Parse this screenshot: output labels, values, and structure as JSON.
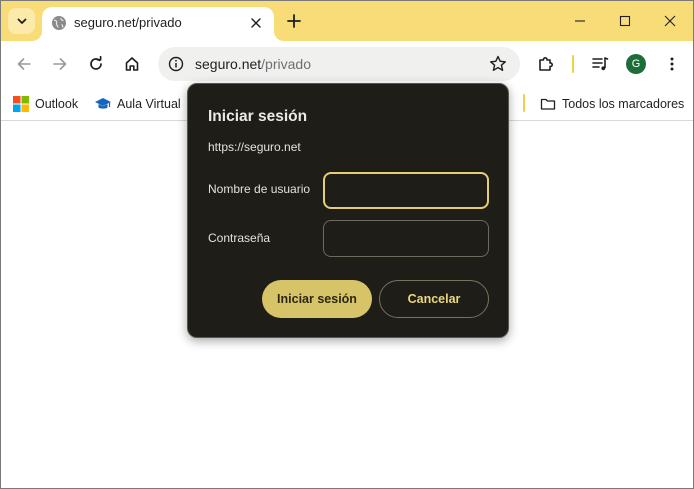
{
  "tab": {
    "title": "seguro.net/privado",
    "favicon": "globe-icon"
  },
  "window_controls": [
    "minimize-icon",
    "maximize-icon",
    "close-icon"
  ],
  "toolbar": {
    "url_host": "seguro.net",
    "url_path": "/privado",
    "profile_initial": "G"
  },
  "bookmarks": [
    {
      "label": "Outlook",
      "icon": "microsoft-logo-icon"
    },
    {
      "label": "Aula Virtual",
      "icon": "graduation-cap-icon"
    },
    {
      "label": "Todos los marcadores",
      "icon": "folder-icon"
    }
  ],
  "dialog": {
    "title": "Iniciar sesión",
    "origin": "https://seguro.net",
    "username_label": "Nombre de usuario",
    "username_value": "",
    "password_label": "Contraseña",
    "password_value": "",
    "submit_label": "Iniciar sesión",
    "cancel_label": "Cancelar"
  },
  "colors": {
    "tabstrip": "#f7dc77",
    "accent_yellow": "#f2cf47",
    "dialog_bg": "#1e1d17",
    "primary_button": "#d8c468",
    "focus_ring": "#e6cf72"
  }
}
